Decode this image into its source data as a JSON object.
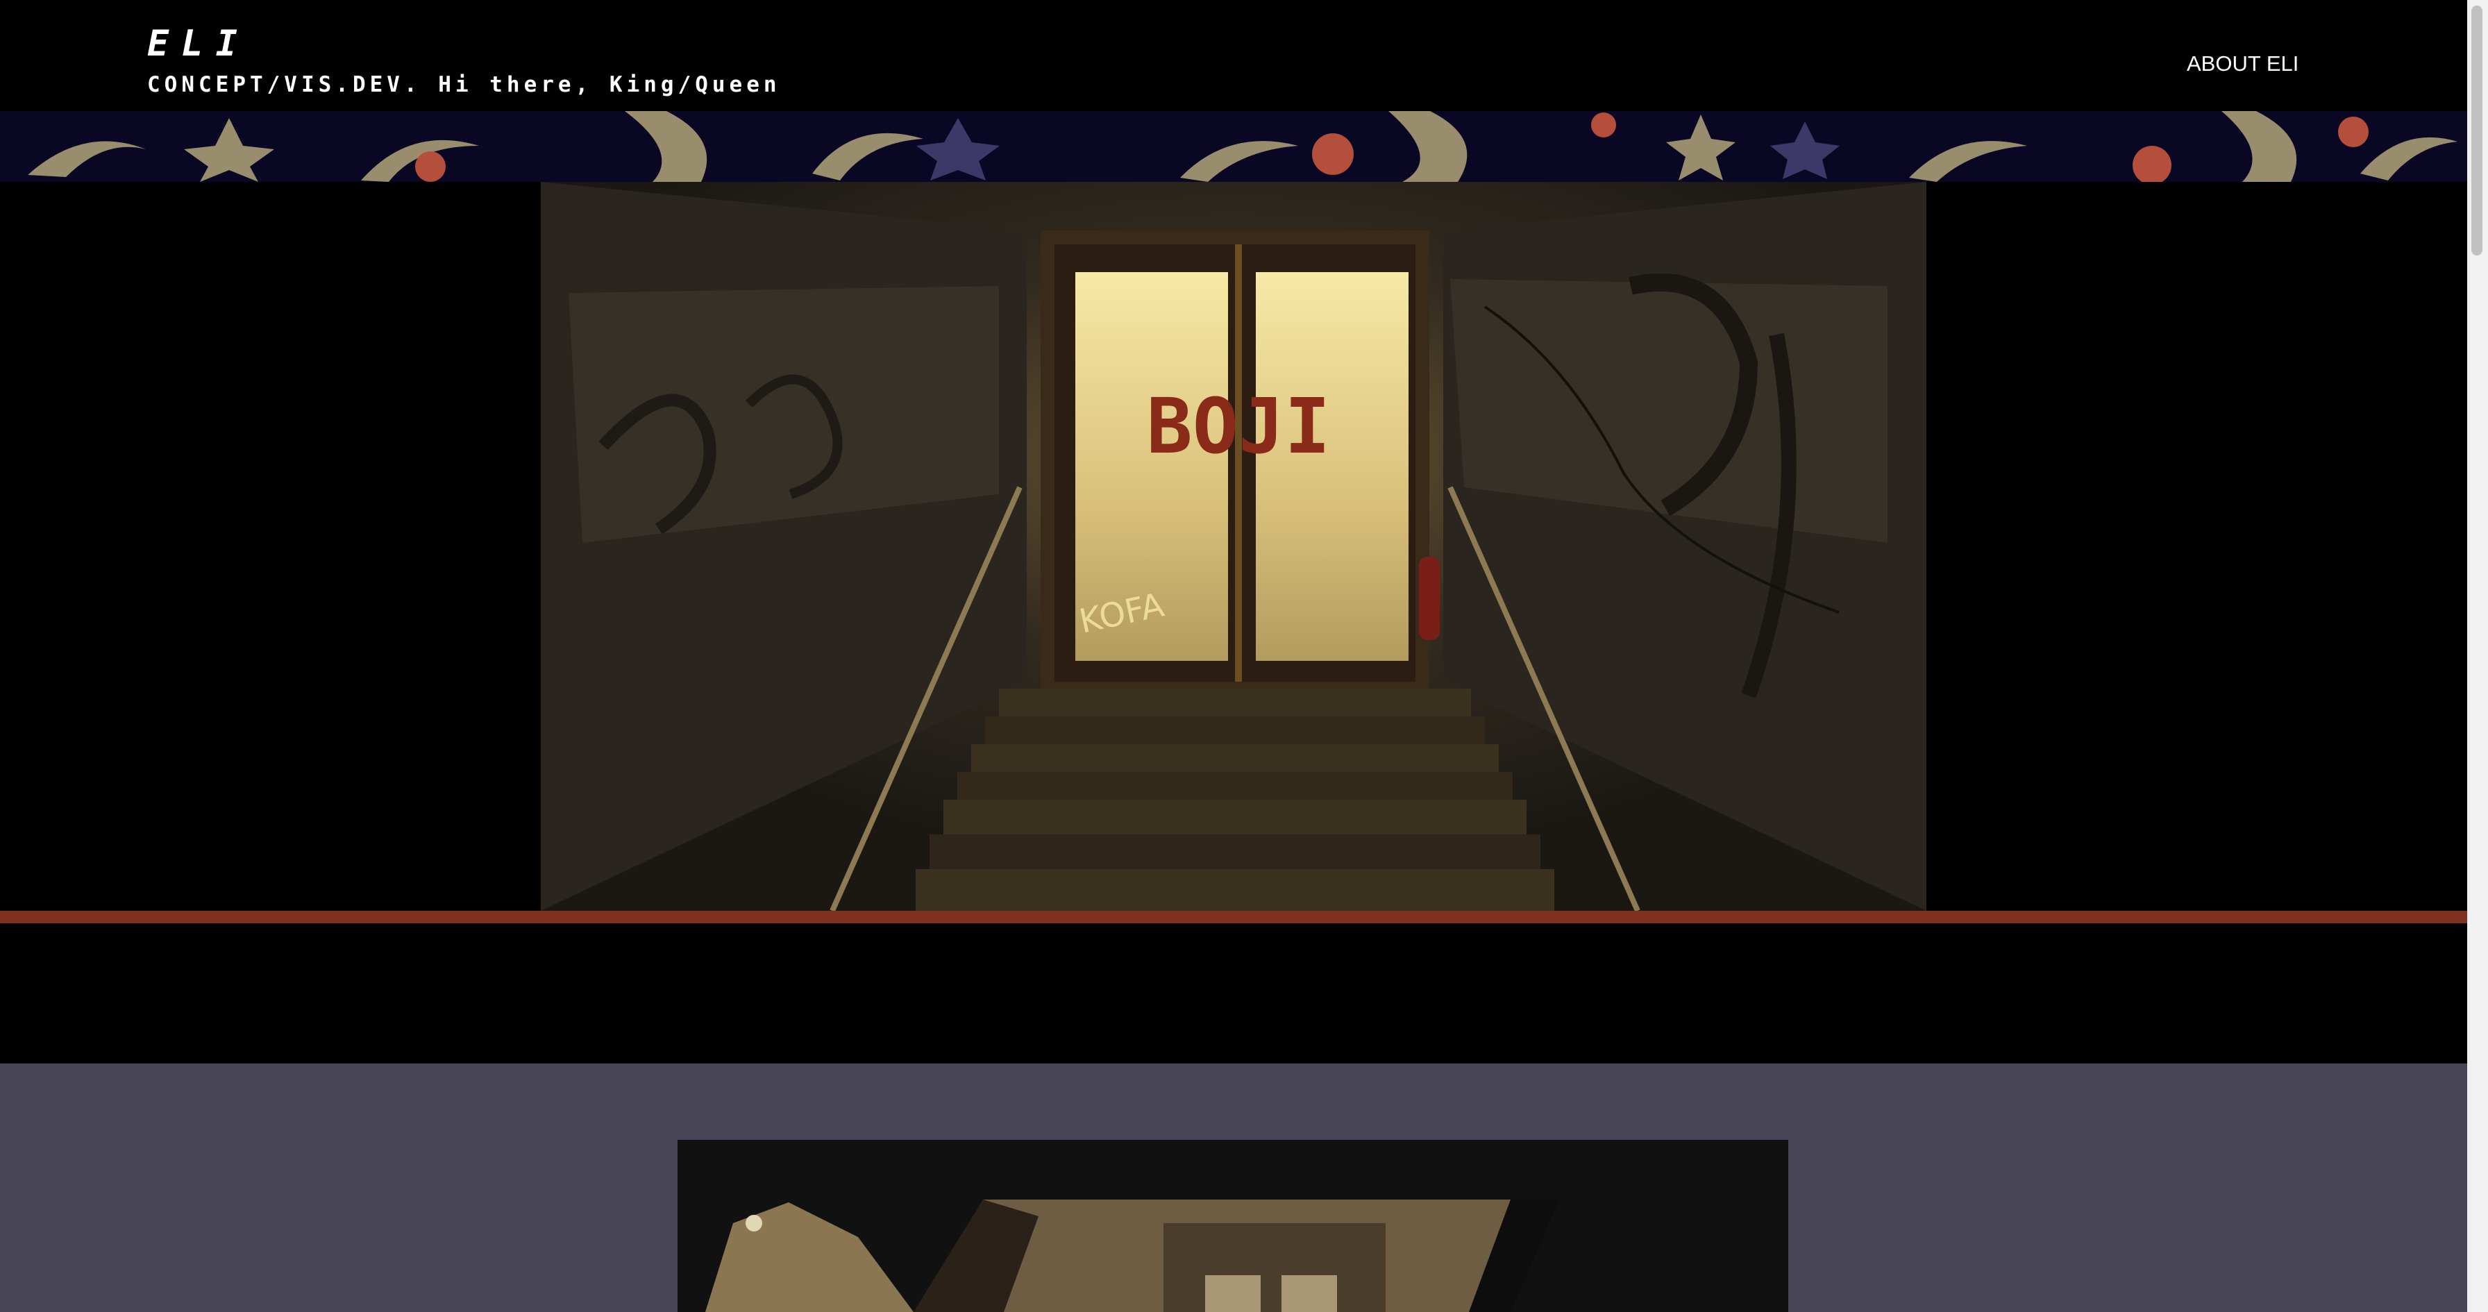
{
  "site": {
    "title": "ELI",
    "tagline": "CONCEPT/VIS.DEV. Hi there, King/Queen"
  },
  "nav": {
    "about_label": "ABOUT ELI"
  },
  "hero": {
    "sign_text": "BOJI",
    "graffiti_text": "KOFA"
  },
  "colors": {
    "background": "#000000",
    "accent_stripe": "#80301e",
    "gallery_bg": "#484557",
    "pattern_bg": "#0a0725"
  }
}
